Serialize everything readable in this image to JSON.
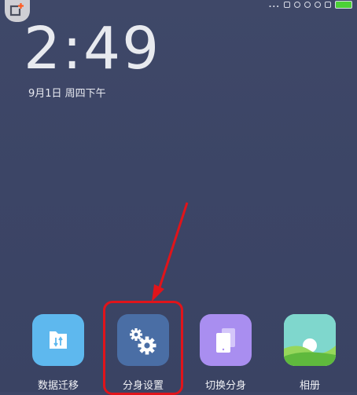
{
  "status_bar": {
    "dots": "...",
    "battery_color": "#4cd137"
  },
  "lockscreen": {
    "time": "2:49",
    "date": "9月1日 周四下午"
  },
  "dock": {
    "apps": [
      {
        "label": "数据迁移",
        "icon": "data-migration-icon",
        "color": "#5eb8ee"
      },
      {
        "label": "分身设置",
        "icon": "gear-settings-icon",
        "color": "#4a6ea5"
      },
      {
        "label": "切换分身",
        "icon": "switch-profile-icon",
        "color": "#a98ef0"
      },
      {
        "label": "相册",
        "icon": "gallery-icon",
        "color": "#7fd7cd"
      }
    ]
  },
  "annotation": {
    "highlight_color": "#e0141a"
  }
}
